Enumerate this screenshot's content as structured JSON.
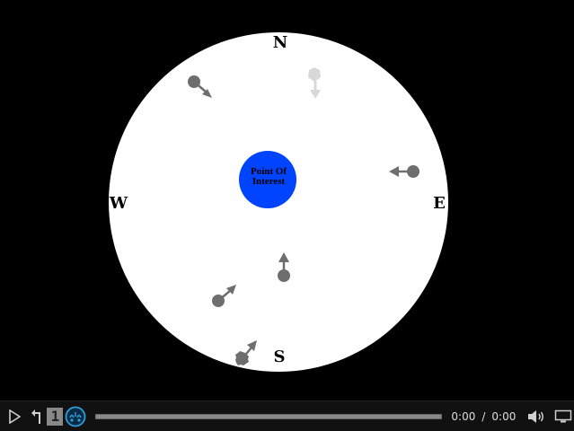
{
  "compass": {
    "north": "N",
    "south": "S",
    "east": "E",
    "west": "W",
    "poi_line1": "Point Of",
    "poi_line2": "Interest",
    "poi_color": "#0044ff",
    "field_color": "#ffffff",
    "marker_color": "#6e6e6e",
    "marker_faded_color": "#d8d8d8"
  },
  "player": {
    "speed_label": "1",
    "current_time": "0:00",
    "separator": "/",
    "total_time": "0:00",
    "progress": 0,
    "icons": {
      "play": "play-icon",
      "back": "return-icon",
      "speed": "speed-icon",
      "captions": "audio-description-icon",
      "volume": "volume-icon",
      "screen": "screen-icon"
    }
  }
}
